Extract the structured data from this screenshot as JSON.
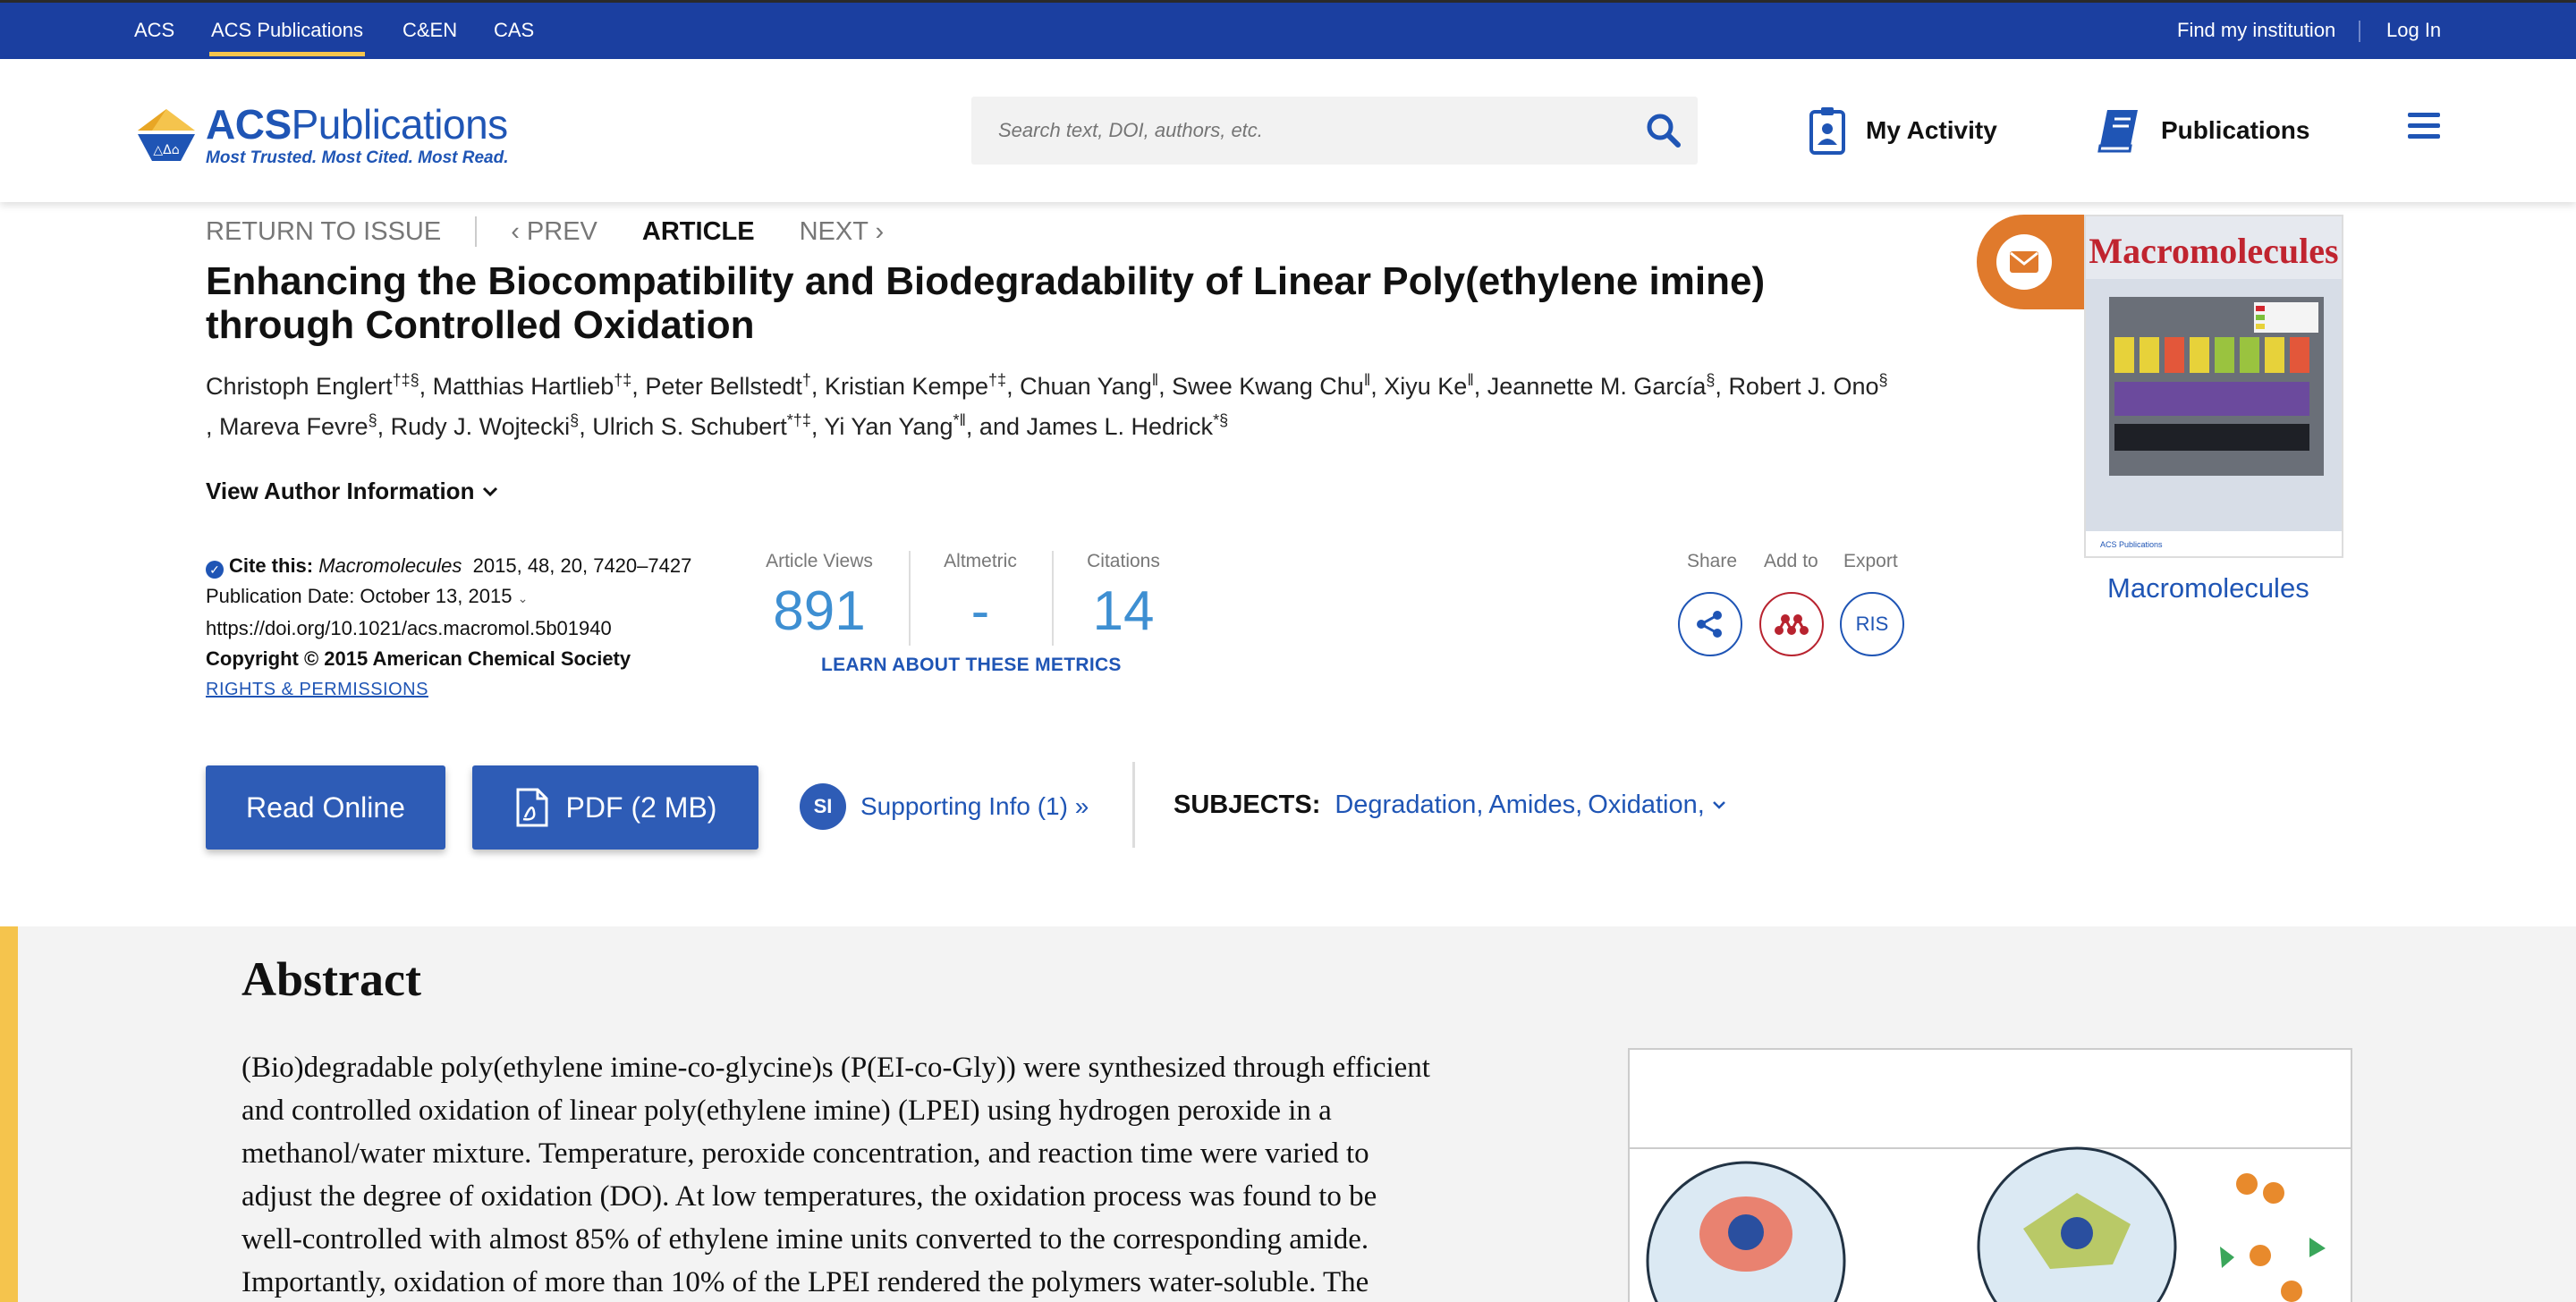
{
  "topbar": {
    "links": [
      "ACS",
      "ACS Publications",
      "C&EN",
      "CAS"
    ],
    "find_institution": "Find my institution",
    "login": "Log In"
  },
  "header": {
    "logo_acs": "ACS",
    "logo_pub": "Publications",
    "logo_tagline": "Most Trusted. Most Cited. Most Read.",
    "search_placeholder": "Search text, DOI, authors, etc.",
    "my_activity": "My Activity",
    "publications": "Publications"
  },
  "issue_nav": {
    "return": "RETURN TO ISSUE",
    "prev": "PREV",
    "current": "ARTICLE",
    "next": "NEXT"
  },
  "article": {
    "title": "Enhancing the Biocompatibility and Biodegradability of Linear Poly(ethylene imine) through Controlled Oxidation",
    "authors": [
      {
        "name": "Christoph Englert",
        "aff": "†‡§"
      },
      {
        "name": "Matthias Hartlieb",
        "aff": "†‡"
      },
      {
        "name": "Peter Bellstedt",
        "aff": "†"
      },
      {
        "name": "Kristian Kempe",
        "aff": "†‡"
      },
      {
        "name": "Chuan Yang",
        "aff": "ǁ"
      },
      {
        "name": "Swee Kwang Chu",
        "aff": "ǁ"
      },
      {
        "name": "Xiyu Ke",
        "aff": "ǁ"
      },
      {
        "name": "Jeannette M. García",
        "aff": "§"
      },
      {
        "name": "Robert J. Ono",
        "aff": "§"
      },
      {
        "name": "Mareva Fevre",
        "aff": "§"
      },
      {
        "name": "Rudy J. Wojtecki",
        "aff": "§"
      },
      {
        "name": "Ulrich S. Schubert",
        "aff": "*†‡"
      },
      {
        "name": "Yi Yan Yang",
        "aff": "*ǁ"
      },
      {
        "name": "James L. Hedrick",
        "aff": "*§"
      }
    ],
    "view_author_info": "View Author Information",
    "cite_label": "Cite this:",
    "cite_journal": "Macromolecules",
    "cite_rest": "2015, 48, 20, 7420–7427",
    "pub_date": "Publication Date: October 13, 2015",
    "doi": "https://doi.org/10.1021/acs.macromol.5b01940",
    "copyright": "Copyright © 2015 American Chemical Society",
    "rights": "RIGHTS & PERMISSIONS"
  },
  "metrics": {
    "views_label": "Article Views",
    "views": "891",
    "altmetric_label": "Altmetric",
    "altmetric": "-",
    "citations_label": "Citations",
    "citations": "14",
    "learn": "LEARN ABOUT THESE METRICS"
  },
  "share": {
    "share_label": "Share",
    "add_label": "Add to",
    "export_label": "Export",
    "ris": "RIS"
  },
  "actions": {
    "read_online": "Read Online",
    "pdf": "PDF (2 MB)",
    "si_badge": "SI",
    "supporting_info": "Supporting Info (1) »",
    "subjects_label": "SUBJECTS:",
    "subjects": [
      "Degradation,",
      "Amides,",
      "Oxidation,"
    ]
  },
  "journal": {
    "cover_title": "Macromolecules",
    "name": "Macromolecules"
  },
  "abstract": {
    "heading": "Abstract",
    "text_lines": [
      "(Bio)degradable poly(ethylene imine-co-glycine)s (P(EI-co-Gly)) were synthesized through efficient",
      "and controlled oxidation of linear poly(ethylene imine) (LPEI) using hydrogen peroxide in a",
      "methanol/water mixture. Temperature, peroxide concentration, and reaction time were varied to",
      "adjust the degree of oxidation (DO). At low temperatures, the oxidation process was found to be",
      "well-controlled with almost 85% of ethylene imine units converted to the corresponding amide.",
      "Importantly, oxidation of more than 10% of the LPEI rendered the polymers water-soluble. The"
    ]
  },
  "colors": {
    "topbar": "#1b3fa0",
    "brand_blue": "#1f55b5",
    "button_blue": "#2e5cb6",
    "metric_blue": "#3e8fd2",
    "accent_yellow": "#f5c44d",
    "mail_orange": "#e07a2c",
    "mendeley_red": "#b8232f"
  },
  "icons": [
    "search-icon",
    "clipboard-icon",
    "book-icon",
    "menu-icon",
    "chevron-down-icon",
    "check-circle-icon",
    "share-icon",
    "mendeley-icon",
    "pdf-icon",
    "envelope-icon"
  ]
}
